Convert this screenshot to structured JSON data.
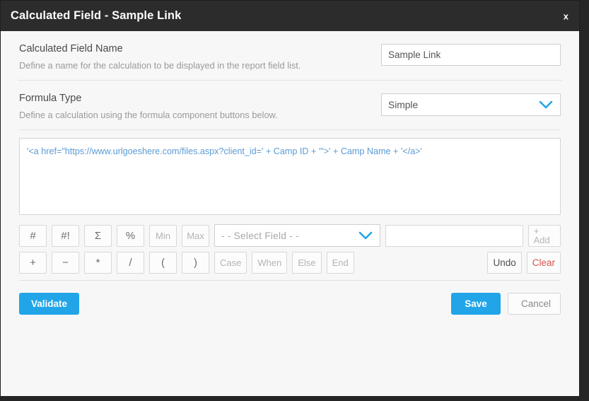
{
  "window": {
    "title": "Calculated Field - Sample Link",
    "close_label": "x"
  },
  "fields": {
    "name": {
      "label": "Calculated Field Name",
      "description": "Define a name for the calculation to be displayed in the report field list.",
      "value": "Sample Link",
      "placeholder": ""
    },
    "formula_type": {
      "label": "Formula Type",
      "description": "Define a calculation using the formula component buttons below.",
      "value": "Simple"
    }
  },
  "formula": {
    "text": "'<a href=\"https://www.urlgoeshere.com/files.aspx?client_id=' + Camp ID + '\">' + Camp Name + '</a>'",
    "color": "#5b9bd5"
  },
  "toolbar": {
    "row1": [
      {
        "label": "#",
        "state": "enabled"
      },
      {
        "label": "#!",
        "state": "enabled"
      },
      {
        "label": "Σ",
        "state": "enabled"
      },
      {
        "label": "%",
        "state": "enabled"
      },
      {
        "label": "Min",
        "state": "disabled"
      },
      {
        "label": "Max",
        "state": "disabled"
      }
    ],
    "row2": [
      {
        "label": "+",
        "state": "enabled"
      },
      {
        "label": "−",
        "state": "enabled"
      },
      {
        "label": "*",
        "state": "enabled"
      },
      {
        "label": "/",
        "state": "enabled"
      },
      {
        "label": "(",
        "state": "enabled"
      },
      {
        "label": ")",
        "state": "enabled"
      },
      {
        "label": "Case",
        "state": "disabled"
      },
      {
        "label": "When",
        "state": "disabled"
      },
      {
        "label": "Else",
        "state": "disabled"
      },
      {
        "label": "End",
        "state": "disabled"
      }
    ],
    "select_field_placeholder": "- - Select Field - -",
    "value_input_value": "",
    "value_input_placeholder": "",
    "add_label": "+ Add",
    "undo_label": "Undo",
    "clear_label": "Clear"
  },
  "footer": {
    "validate_label": "Validate",
    "save_label": "Save",
    "cancel_label": "Cancel"
  },
  "colors": {
    "titlebar": "#2c2c2c",
    "primary": "#21a5e8",
    "danger": "#d9534f",
    "formula_text": "#5b9bd5"
  }
}
